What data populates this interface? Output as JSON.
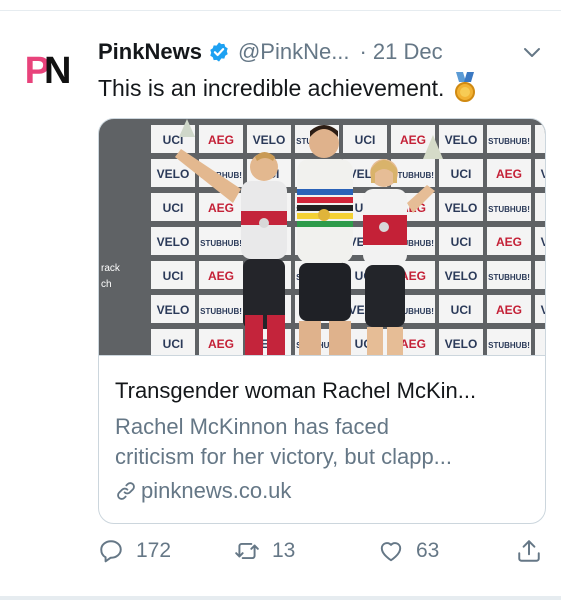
{
  "tweet": {
    "author_name": "PinkNews",
    "handle": "@PinkNe...",
    "separator": "·",
    "date": "21 Dec",
    "text": "This is an incredible achievement.",
    "avatar_letters": {
      "p": "P",
      "n": "N"
    }
  },
  "card": {
    "title": "Transgender woman Rachel McKin...",
    "description_line1": "Rachel McKinnon has faced",
    "description_line2": "criticism for her victory, but clapp...",
    "domain": "pinknews.co.uk",
    "image_banner_words": [
      "UCI",
      "AEG",
      "VELO",
      "STUBHUB!"
    ],
    "image_side_text": [
      "rack",
      "ch"
    ]
  },
  "actions": {
    "replies": "172",
    "retweets": "13",
    "likes": "63"
  },
  "colors": {
    "brand_pink": "#e8437b",
    "verified_blue": "#1da1f2",
    "secondary_text": "#657786",
    "border": "#ccd6dd"
  },
  "icons": [
    "verified-badge-icon",
    "chevron-down-icon",
    "medal-icon",
    "link-icon",
    "reply-icon",
    "retweet-icon",
    "like-icon",
    "share-icon"
  ]
}
